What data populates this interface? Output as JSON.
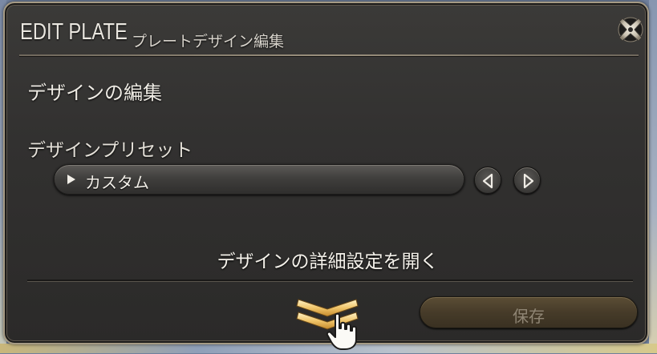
{
  "window": {
    "title_en": "EDIT PLATE",
    "title_jp": "プレートデザイン編集"
  },
  "section": {
    "heading": "デザインの編集",
    "preset_label": "デザインプリセット"
  },
  "preset_dropdown": {
    "selected": "カスタム"
  },
  "advanced": {
    "link_label": "デザインの詳細設定を開く"
  },
  "footer": {
    "save_label": "保存"
  },
  "icons": {
    "close": "close-icon",
    "prev": "chevron-left-icon",
    "next": "chevron-right-icon",
    "expand": "double-chevron-down-icon",
    "cursor": "hand-pointer-icon"
  },
  "colors": {
    "accent_gold": "#e6b95a",
    "panel_bg": "#323130",
    "frame": "#a59a84"
  }
}
